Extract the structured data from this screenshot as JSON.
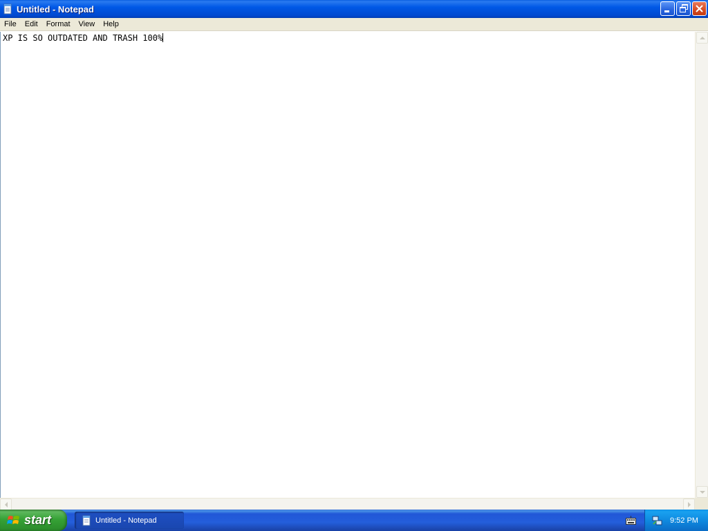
{
  "window": {
    "title": "Untitled - Notepad",
    "icon": "notepad-icon"
  },
  "menu": {
    "items": [
      "File",
      "Edit",
      "Format",
      "View",
      "Help"
    ]
  },
  "editor": {
    "text": "XP IS SO OUTDATED AND TRASH 100%"
  },
  "taskbar": {
    "start_label": "start",
    "task_button_label": "Untitled - Notepad",
    "clock": "9:52 PM"
  },
  "colors": {
    "titlebar_blue": "#0058e6",
    "taskbar_blue": "#245edb",
    "start_green": "#36a236",
    "tray_blue": "#0f8ae0",
    "menu_bg": "#ece9d8"
  }
}
